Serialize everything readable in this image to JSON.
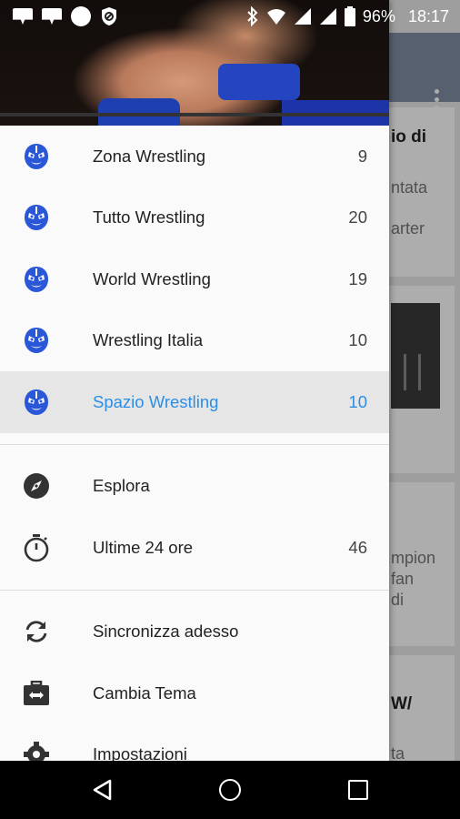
{
  "status_bar": {
    "battery": "96%",
    "time": "18:17"
  },
  "background": {
    "card1_lines": [
      "io di",
      "ntata",
      "arter"
    ],
    "card3_lines": [
      "mpion",
      "fan",
      "di"
    ],
    "card4_lines": [
      "W/",
      "ta"
    ]
  },
  "drawer": {
    "feeds": [
      {
        "label": "Zona Wrestling",
        "count": "9",
        "icon": "wrestling-mask-icon"
      },
      {
        "label": "Tutto Wrestling",
        "count": "20",
        "icon": "wrestling-mask-icon"
      },
      {
        "label": "World Wrestling",
        "count": "19",
        "icon": "wrestling-mask-icon"
      },
      {
        "label": "Wrestling Italia",
        "count": "10",
        "icon": "wrestling-mask-icon"
      },
      {
        "label": "Spazio Wrestling",
        "count": "10",
        "icon": "wrestling-mask-icon",
        "selected": true
      }
    ],
    "explore": {
      "label": "Esplora",
      "icon": "compass-icon"
    },
    "last24": {
      "label": "Ultime 24 ore",
      "count": "46",
      "icon": "stopwatch-icon"
    },
    "sync": {
      "label": "Sincronizza adesso",
      "icon": "sync-icon"
    },
    "theme": {
      "label": "Cambia Tema",
      "icon": "theme-toggle-icon"
    },
    "settings": {
      "label": "Impostazioni",
      "icon": "gear-icon"
    }
  },
  "colors": {
    "accent": "#2d8ee6",
    "mask_blue": "#2a56d8",
    "drawer_bg": "#fafafa",
    "selected_bg": "#e6e6e6"
  }
}
